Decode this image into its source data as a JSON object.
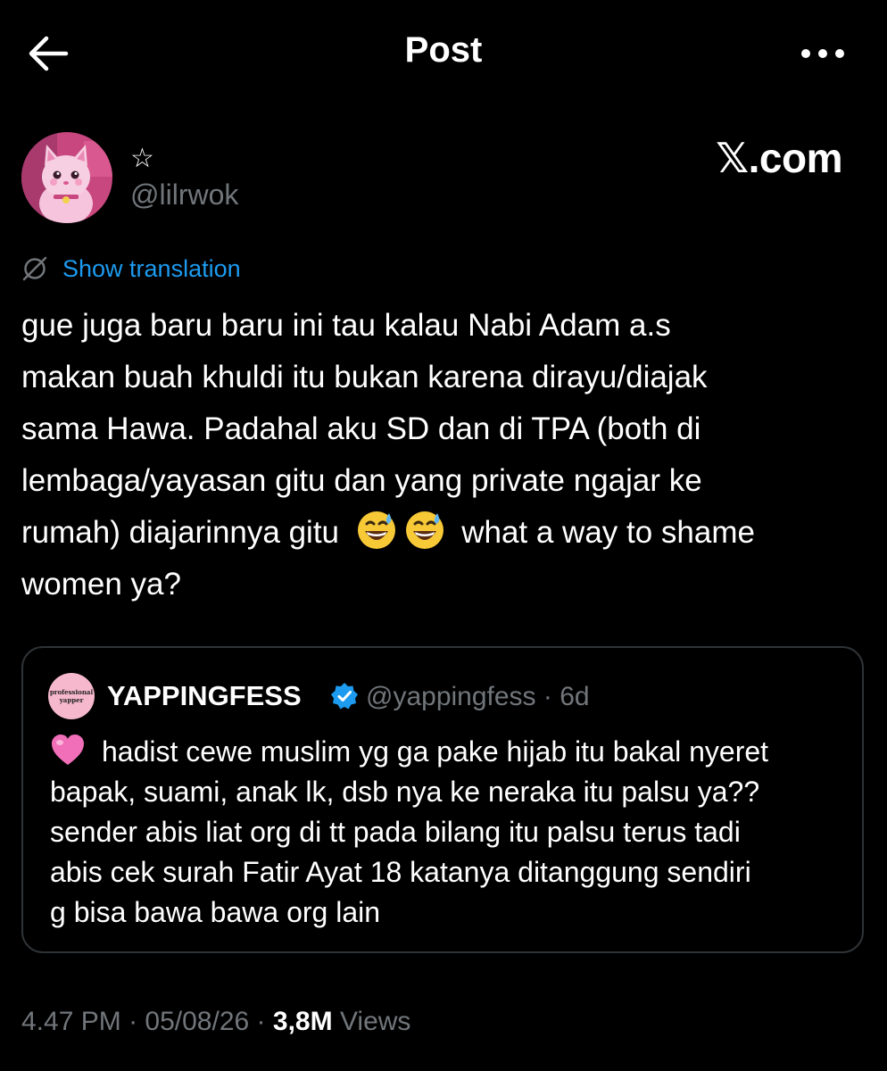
{
  "header": {
    "title": "Post",
    "back_icon": "arrow-left-icon",
    "more_icon": "more-horizontal-icon"
  },
  "author": {
    "display_name": "☆",
    "handle": "@lilrwok",
    "avatar_icon": "pink-cat-avatar"
  },
  "watermark": "𝕏.com",
  "translation": {
    "label": "Show translation",
    "icon": "translate-globe-icon"
  },
  "post": {
    "lines": [
      "gue juga baru baru ini tau kalau Nabi Adam a.s",
      "makan buah khuldi itu bukan karena dirayu/diajak",
      "sama Hawa. Padahal aku SD dan di TPA (both di",
      "lembaga/yayasan gitu dan yang private ngajar ke",
      "rumah) diajarinnya gitu",
      "what a way to shame",
      "women ya?"
    ],
    "emoji": "grinning-face-with-sweat-emoji"
  },
  "quote": {
    "avatar_text_1": "professional",
    "avatar_text_2": "yapper",
    "name": "YAPPINGFESS",
    "verified_icon": "verified-badge-icon",
    "meta": "@yappingfess · 6d",
    "heart_icon": "pink-heart-emoji",
    "lines": [
      "hadist cewe muslim yg ga pake hijab itu bakal nyeret",
      "bapak, suami, anak lk, dsb nya ke neraka itu palsu ya??",
      "sender abis liat org di tt pada bilang itu palsu terus tadi",
      "abis cek surah Fatir Ayat 18 katanya ditanggung sendiri",
      "g bisa bawa bawa org lain"
    ]
  },
  "footer": {
    "time": "4.47 PM",
    "separator": "·",
    "date": "05/08/26",
    "views_count": "3,8M",
    "views_label": "Views"
  },
  "colors": {
    "background": "#000000",
    "text": "#ffffff",
    "secondary": "#71767b",
    "link": "#1d9bf0",
    "border": "#2f3336"
  }
}
